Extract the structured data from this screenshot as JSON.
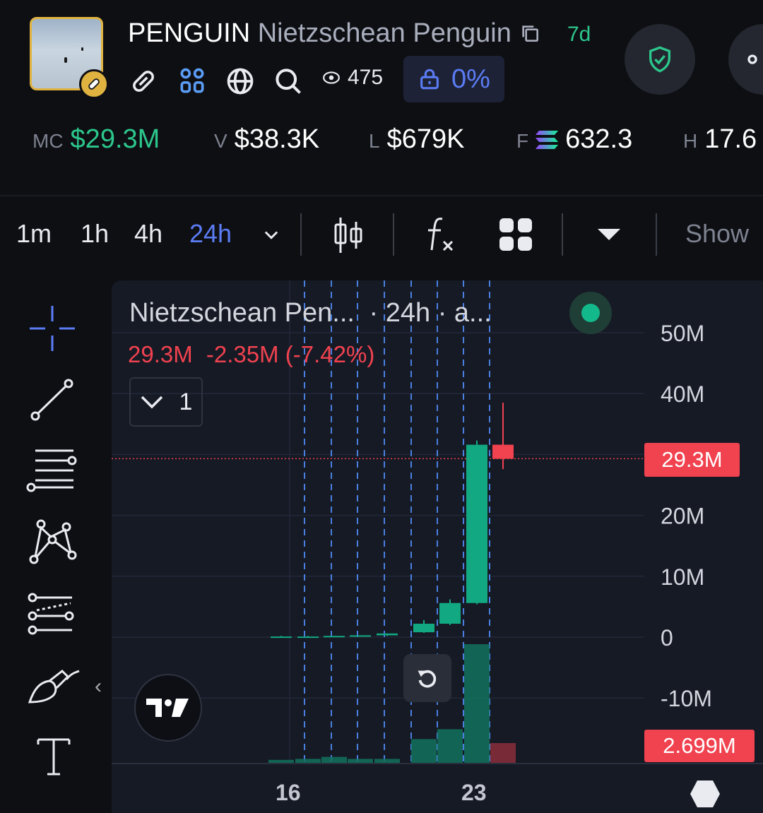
{
  "token": {
    "symbol": "PENGUIN",
    "name": "Nietzschean Penguin",
    "age": "7d",
    "views": "475",
    "locked_pct": "0%"
  },
  "stats": [
    {
      "key": "MC",
      "value": "$29.3M",
      "color": "#2cc78c"
    },
    {
      "key": "V",
      "value": "$38.3K",
      "color": "#ffffff"
    },
    {
      "key": "L",
      "value": "$679K",
      "color": "#ffffff"
    },
    {
      "key": "F",
      "value": "632.3",
      "color": "#ffffff"
    },
    {
      "key": "H",
      "value": "17.6",
      "color": "#ffffff"
    }
  ],
  "toolbar": {
    "intervals": [
      "1m",
      "1h",
      "4h",
      "24h"
    ],
    "active_interval": "24h",
    "show_label": "Show"
  },
  "chart_header": {
    "title": "Nietzschean Pen...",
    "suffix": "· 24h · a...",
    "last": "29.3M",
    "change": "-2.35M",
    "change_pct": "(-7.42%)",
    "collapse_count": "1"
  },
  "chart_data": {
    "type": "candlestick",
    "y_ticks": [
      "50M",
      "40M",
      "20M",
      "10M",
      "0",
      "-10M"
    ],
    "x_ticks": [
      "16",
      "23"
    ],
    "last_price_label": "29.3M",
    "volume_label": "2.699M",
    "ylim": [
      -20,
      55
    ],
    "candles": [
      {
        "o": 0.1,
        "h": 0.2,
        "l": 0.0,
        "c": 0.1,
        "up": true
      },
      {
        "o": 0.1,
        "h": 0.2,
        "l": 0.0,
        "c": 0.1,
        "up": true
      },
      {
        "o": 0.1,
        "h": 0.2,
        "l": 0.0,
        "c": 0.2,
        "up": true
      },
      {
        "o": 0.2,
        "h": 0.3,
        "l": 0.1,
        "c": 0.3,
        "up": true
      },
      {
        "o": 0.3,
        "h": 0.6,
        "l": 0.2,
        "c": 0.6,
        "up": true
      },
      {
        "o": 0.8,
        "h": 2.8,
        "l": 0.7,
        "c": 2.2,
        "up": true
      },
      {
        "o": 2.2,
        "h": 6.2,
        "l": 2.0,
        "c": 5.6,
        "up": true
      },
      {
        "o": 5.6,
        "h": 32.3,
        "l": 5.4,
        "c": 31.6,
        "up": true
      },
      {
        "o": 31.6,
        "h": 38.5,
        "l": 27.6,
        "c": 29.3,
        "up": false
      }
    ],
    "volumes": [
      0.15,
      0.2,
      0.3,
      0.2,
      0.2,
      1.2,
      1.7,
      6.0,
      1.0
    ],
    "colors": {
      "up": "#12a982",
      "down": "#f0424f"
    }
  }
}
